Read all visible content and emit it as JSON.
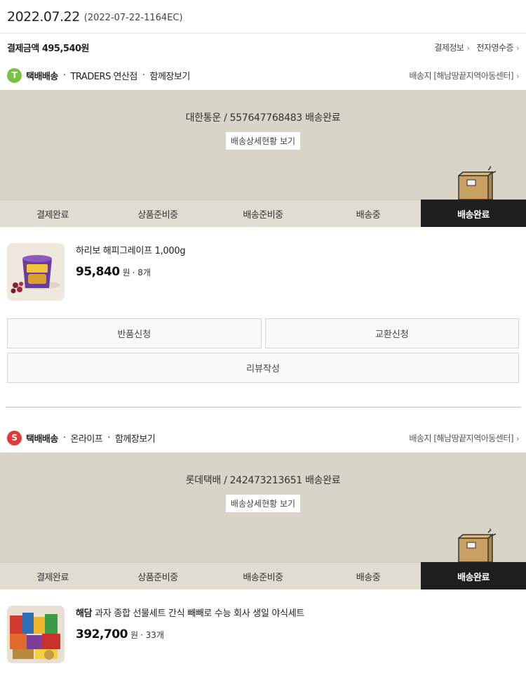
{
  "order": {
    "date": "2022.07.22",
    "number": "(2022-07-22-1164EC)",
    "pay_label": "결제금액",
    "pay_amount": "495,540원",
    "pay_info_link": "결제정보",
    "receipt_link": "전자영수증"
  },
  "steps": [
    "결제완료",
    "상품준비중",
    "배송준비중",
    "배송중",
    "배송완료"
  ],
  "shipments": [
    {
      "badge": "T",
      "badge_color": "#7ac143",
      "type": "택배배송",
      "store": "TRADERS 연산점",
      "cart_link": "함께장보기",
      "destination": "배송지 [해남땅끝지역아동센터]",
      "carrier_status": "대한통운 / 557647768483 배송완료",
      "detail_button": "배송상세현황 보기",
      "active_step": "배송완료",
      "product": {
        "brand": "",
        "name": "하리보 해피그레이프 1,000g",
        "price": "95,840",
        "won": "원",
        "qty": "· 8개",
        "thumb_icon": "gummy-jar-image"
      },
      "actions": {
        "return": "반품신청",
        "exchange": "교환신청",
        "review": "리뷰작성"
      }
    },
    {
      "badge": "S",
      "badge_color": "#e23b35",
      "type": "택배배송",
      "store": "온라이프",
      "cart_link": "함께장보기",
      "destination": "배송지 [해남땅끝지역아동센터]",
      "carrier_status": "롯데택배 / 242473213651 배송완료",
      "detail_button": "배송상세현황 보기",
      "active_step": "배송완료",
      "product": {
        "brand": "해담",
        "name": "과자 종합 선물세트 간식 빼빼로 수능 회사 생일 야식세트",
        "price": "392,700",
        "won": "원",
        "qty": "· 33개",
        "thumb_icon": "snack-set-image"
      }
    }
  ]
}
